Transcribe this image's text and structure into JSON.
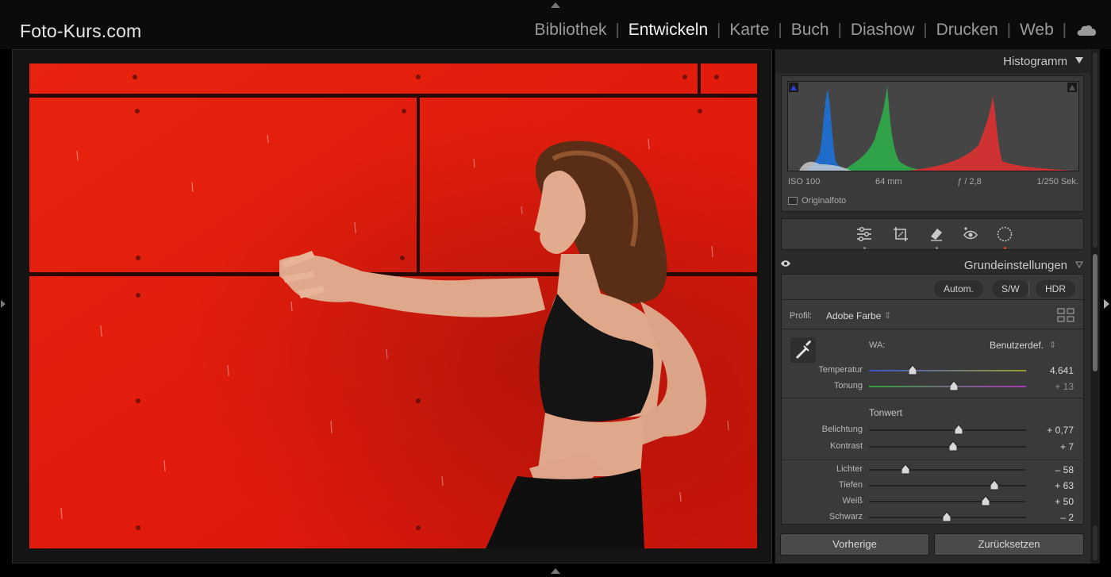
{
  "app": {
    "brand": "Foto-Kurs.com",
    "modules": [
      {
        "label": "Bibliothek",
        "active": false
      },
      {
        "label": "Entwickeln",
        "active": true
      },
      {
        "label": "Karte",
        "active": false
      },
      {
        "label": "Buch",
        "active": false
      },
      {
        "label": "Diashow",
        "active": false
      },
      {
        "label": "Drucken",
        "active": false
      },
      {
        "label": "Web",
        "active": false
      }
    ],
    "cloud_icon": "cloud-icon"
  },
  "photo": {
    "subject": "woman-red-wall-photo",
    "wall_color": "#e11d0f"
  },
  "histogram": {
    "title": "Histogramm",
    "iso": "ISO 100",
    "focal": "64 mm",
    "aperture": "ƒ / 2,8",
    "shutter": "1/250 Sek.",
    "original_label": "Originalfoto",
    "colors": {
      "blue": "#1f6fd1",
      "green": "#2fa84b",
      "red": "#d63232"
    }
  },
  "tools": [
    "sliders-icon",
    "crop-icon",
    "eraser-icon",
    "red-eye-icon",
    "mask-icon"
  ],
  "basic": {
    "title": "Grundeinstellungen",
    "auto": "Autom.",
    "bw": "S/W",
    "hdr": "HDR",
    "profile_label": "Profil:",
    "profile_value": "Adobe Farbe",
    "wb_label": "WA:",
    "wb_value": "Benutzerdef.",
    "tone_label": "Tonwert",
    "sliders": {
      "temperatur": {
        "label": "Temperatur",
        "value": "4.641",
        "pos": 0.28
      },
      "tonung": {
        "label": "Tonung",
        "value": "+ 13",
        "pos": 0.54
      },
      "belichtung": {
        "label": "Belichtung",
        "value": "+ 0,77",
        "pos": 0.57
      },
      "kontrast": {
        "label": "Kontrast",
        "value": "+ 7",
        "pos": 0.535
      },
      "lichter": {
        "label": "Lichter",
        "value": "– 58",
        "pos": 0.23
      },
      "tiefen": {
        "label": "Tiefen",
        "value": "+ 63",
        "pos": 0.8
      },
      "weiss": {
        "label": "Weiß",
        "value": "+ 50",
        "pos": 0.74
      },
      "schwarz": {
        "label": "Schwarz",
        "value": "– 2",
        "pos": 0.495
      }
    }
  },
  "footer": {
    "previous": "Vorherige",
    "reset": "Zurücksetzen"
  }
}
